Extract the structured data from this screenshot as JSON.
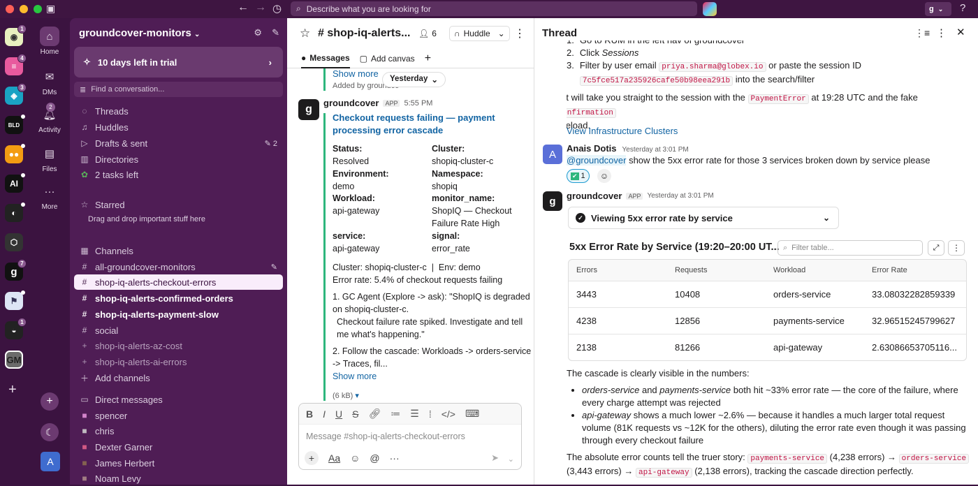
{
  "search": {
    "placeholder": "Describe what you are looking for"
  },
  "user_initial": "g",
  "rail": {
    "badges": [
      "1",
      "4",
      "3",
      "",
      "",
      "",
      "",
      "",
      "7",
      "",
      "1"
    ],
    "gm": "GM",
    "avatar": "A"
  },
  "nav": {
    "home": "Home",
    "dms": "DMs",
    "activity": "Activity",
    "activity_badge": "2",
    "files": "Files",
    "more": "More"
  },
  "sidebar": {
    "workspace": "groundcover-monitors",
    "trial": "10 days left in trial",
    "find": "Find a conversation...",
    "items": [
      "Threads",
      "Huddles",
      "Drafts & sent",
      "Directories",
      "2 tasks left"
    ],
    "drafts_count": "2",
    "starred_label": "Starred",
    "starred_hint": "Drag and drop important stuff here",
    "channels_label": "Channels",
    "channels": [
      "all-groundcover-monitors",
      "shop-iq-alerts-checkout-errors",
      "shop-iq-alerts-confirmed-orders",
      "shop-iq-alerts-payment-slow",
      "social",
      "shop-iq-alerts-az-cost",
      "shop-iq-alerts-ai-errors"
    ],
    "add_channels": "Add channels",
    "dm_label": "Direct messages",
    "dms": [
      "spencer",
      "chris",
      "Dexter Garner",
      "James Herbert",
      "Noam Levy"
    ]
  },
  "channel": {
    "name": "# shop-iq-alerts...",
    "members": "6",
    "huddle": "Huddle",
    "tab_messages": "Messages",
    "tab_canvas": "Add canvas",
    "show_more_top": "Show more",
    "added_by": "Added by groundco",
    "date_pill": "Yesterday",
    "sender": "groundcover",
    "app": "APP",
    "time": "5:55 PM",
    "title": "Checkout requests failing — payment processing error cascade",
    "fields": [
      {
        "k": "Status:",
        "v": "Resolved"
      },
      {
        "k": "Cluster:",
        "v": "shopiq-cluster-c"
      },
      {
        "k": "Environment:",
        "v": "demo"
      },
      {
        "k": "Namespace:",
        "v": "shopiq"
      },
      {
        "k": "Workload:",
        "v": "api-gateway"
      },
      {
        "k": "monitor_name:",
        "v": "ShopIQ — Checkout Failure Rate High"
      },
      {
        "k": "service:",
        "v": "api-gateway"
      },
      {
        "k": "signal:",
        "v": "error_rate"
      }
    ],
    "line1": "Cluster: shopiq-cluster-c  |  Env: demo",
    "line2": "Error rate: 5.4% of checkout requests failing",
    "step1": "1. GC Agent (Explore -> ask): \"ShopIQ is degraded on shopiq-cluster-c.",
    "step1b": "Checkout failure rate spiked. Investigate and tell me what's happening.\"",
    "step2": "2. Follow the cascade: Workloads -> orders-service -> Traces, fil...",
    "show_more": "Show more",
    "file_size": "(6 kB)",
    "composer_placeholder": "Message #shop-iq-alerts-checkout-errors"
  },
  "thread": {
    "title": "Thread",
    "step1": "Go to RUM in the left nav of groundcover",
    "step2_pre": "Click ",
    "step2_em": "Sessions",
    "step3_pre": "Filter by user email ",
    "email": "priya.sharma@globex.io",
    "step3_mid": " or paste the session ID",
    "session": "7c5fce517a235926cafe50b98eea291b",
    "step3_post": " into the search/filter",
    "para1_pre": "That will take you straight to the session with the ",
    "payment_error": "PaymentError",
    "para1_mid": " at 19:28 UTC and the fake ",
    "confirmation": "/confirmation",
    "para1_post": "pageload.",
    "link": "View Infrastructure Clusters",
    "user": "Anais Dotis",
    "user_time": "Yesterday at 3:01 PM",
    "mention": "@groundcover",
    "user_msg": " show the 5xx error rate for those 3 services broken down by service please",
    "reaction_count": "1",
    "bot": "groundcover",
    "bot_app": "APP",
    "bot_time": "Yesterday at 3:01 PM",
    "viewing": "Viewing 5xx error rate by service",
    "table_title": "5xx Error Rate by Service (19:20–20:00 UT...",
    "filter_placeholder": "Filter table...",
    "columns": [
      "Errors",
      "Requests",
      "Workload",
      "Error Rate"
    ],
    "rows": [
      [
        "3443",
        "10408",
        "orders-service",
        "33.08032282859339"
      ],
      [
        "4238",
        "12856",
        "payments-service",
        "32.96515245799627"
      ],
      [
        "2138",
        "81266",
        "api-gateway",
        "2.63086653705116..."
      ]
    ],
    "summary": "The cascade is clearly visible in the numbers:",
    "b1_em1": "orders-service",
    "b1_and": " and ",
    "b1_em2": "payments-service",
    "b1_rest": " both hit ~33% error rate — the core of the failure, where every charge attempt was rejected",
    "b2_em": "api-gateway",
    "b2_rest": " shows a much lower ~2.6% — because it handles a much larger total request volume (81K requests vs ~12K for the others), diluting the error rate even though it was passing through every checkout failure",
    "abs_pre": "The absolute error counts tell the truer story: ",
    "c1": "payments-service",
    "abs_1": " (4,238 errors) → ",
    "c2": "orders-service",
    "abs_2": " (3,443 errors) → ",
    "c3": "api-gateway",
    "abs_3": " (2,138 errors), tracking the cascade direction perfectly."
  }
}
